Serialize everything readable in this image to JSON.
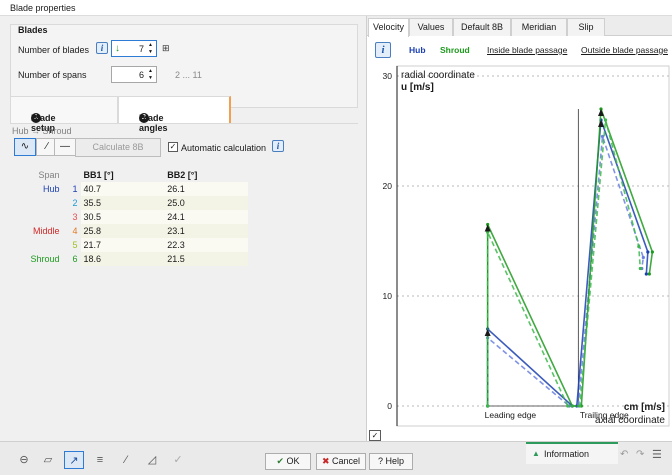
{
  "window": {
    "title": "Blade properties"
  },
  "blades_group": {
    "title": "Blades",
    "number_of_blades_label": "Number of blades",
    "number_of_blades_value": "7",
    "number_of_spans_label": "Number of spans",
    "number_of_spans_value": "6",
    "spans_range": "2 ... 11"
  },
  "setup_tabs": {
    "blade_setup": {
      "num": "1",
      "label": "Blade setup"
    },
    "blade_angles": {
      "num": "2",
      "label": "Blade angles"
    }
  },
  "angles": {
    "hub_shroud_label": "Hub → Shroud",
    "calculate_label": "Calculate 8B",
    "auto_calc_label": "Automatic calculation"
  },
  "table": {
    "headers": {
      "span": "Span",
      "bb1": "BB1 [°]",
      "bb2": "BB2 [°]"
    },
    "rows": [
      {
        "name": "Hub",
        "name_color": "#1a3fb0",
        "num": "1",
        "num_color": "#1a3fb0",
        "bb1": "40.7",
        "bb2": "26.1"
      },
      {
        "name": "",
        "name_color": "#1a1a1a",
        "num": "2",
        "num_color": "#1a9ad6",
        "bb1": "35.5",
        "bb2": "25.0"
      },
      {
        "name": "",
        "name_color": "#1a1a1a",
        "num": "3",
        "num_color": "#e05050",
        "bb1": "30.5",
        "bb2": "24.1"
      },
      {
        "name": "Middle",
        "name_color": "#d02828",
        "num": "4",
        "num_color": "#e07a20",
        "bb1": "25.8",
        "bb2": "23.1"
      },
      {
        "name": "",
        "name_color": "#1a1a1a",
        "num": "5",
        "num_color": "#a0c020",
        "bb1": "21.7",
        "bb2": "22.3"
      },
      {
        "name": "Shroud",
        "name_color": "#1e9a1e",
        "num": "6",
        "num_color": "#1e9a1e",
        "bb1": "18.6",
        "bb2": "21.5"
      }
    ]
  },
  "right_tabs": [
    "Velocity",
    "Values",
    "Default 8B",
    "Meridian",
    "Slip"
  ],
  "legend": {
    "info": "i",
    "hub": "Hub",
    "hub_color": "#1a3fb0",
    "shroud": "Shroud",
    "shroud_color": "#1e9a1e",
    "inside": "Inside blade passage",
    "outside": "Outside blade passage"
  },
  "chart_data": {
    "type": "line",
    "title": "",
    "corner_labels": {
      "top_left_1": "radial coordinate",
      "top_left_2": "u [m/s]",
      "bottom_right_1": "cm [m/s]",
      "bottom_right_2": "axial coordinate"
    },
    "annotations": [
      "Leading edge",
      "Trailing edge"
    ],
    "ylim": [
      0,
      30
    ],
    "xlim": [
      0,
      18
    ],
    "y_ticks": [
      0,
      10,
      20,
      30
    ],
    "series": [
      {
        "color": "#1a3fb0",
        "values": [
          [
            6,
            0
          ],
          [
            6,
            7
          ],
          [
            11.6,
            0
          ],
          [
            11.9,
            0
          ],
          [
            13.5,
            26
          ],
          [
            16.6,
            14
          ],
          [
            16.5,
            12
          ]
        ]
      },
      {
        "color": "#6a7fe0",
        "values": [
          [
            6,
            0
          ],
          [
            6,
            6.2
          ],
          [
            11.4,
            0
          ],
          [
            12.0,
            0
          ],
          [
            13.6,
            24.5
          ],
          [
            16.3,
            13.5
          ],
          [
            16.2,
            12.5
          ]
        ]
      },
      {
        "color": "#1e9a1e",
        "values": [
          [
            6,
            0
          ],
          [
            6,
            16.5
          ],
          [
            11.6,
            0
          ],
          [
            12.2,
            0
          ],
          [
            13.5,
            27
          ],
          [
            16.9,
            14
          ],
          [
            16.7,
            12
          ]
        ]
      },
      {
        "color": "#3cb84a",
        "values": [
          [
            6,
            0
          ],
          [
            6,
            15.8
          ],
          [
            11.3,
            0
          ],
          [
            12.1,
            0
          ],
          [
            13.8,
            26
          ],
          [
            16.0,
            14.5
          ],
          [
            16.1,
            12.5
          ]
        ]
      }
    ]
  },
  "bottom": {
    "ok": "OK",
    "cancel": "Cancel",
    "help": "Help",
    "information": "Information"
  }
}
